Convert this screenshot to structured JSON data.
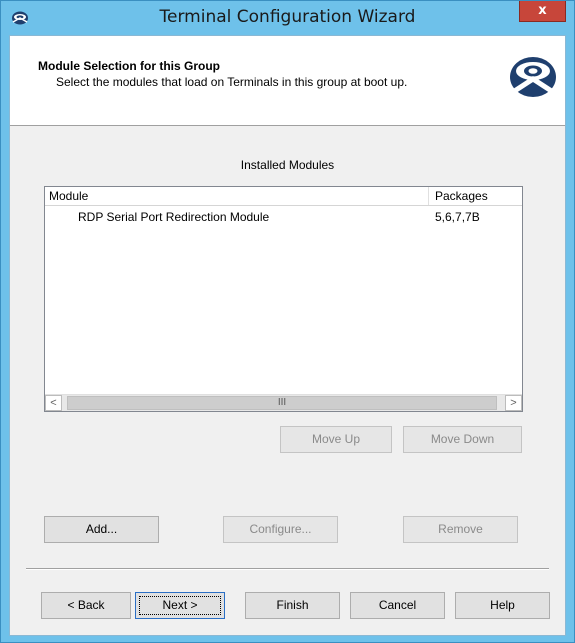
{
  "window": {
    "title": "Terminal Configuration Wizard",
    "close_glyph": "x",
    "accent": "#6ec1ea",
    "close_color": "#c7463a"
  },
  "header": {
    "title": "Module Selection for this Group",
    "subtitle": "Select the modules that load on Terminals in this group at boot up.",
    "logo_icon": "thinmanager-logo"
  },
  "modules": {
    "section_label": "Installed Modules",
    "columns": [
      "Module",
      "Packages"
    ],
    "rows": [
      {
        "module": "RDP Serial Port Redirection Module",
        "packages": "5,6,7,7B"
      }
    ],
    "scroll_left": "<",
    "scroll_right": ">",
    "scroll_thumb": "III"
  },
  "buttons": {
    "move_up": "Move Up",
    "move_down": "Move Down",
    "add": "Add...",
    "configure": "Configure...",
    "remove": "Remove",
    "back": "< Back",
    "next": "Next >",
    "finish": "Finish",
    "cancel": "Cancel",
    "help": "Help"
  }
}
